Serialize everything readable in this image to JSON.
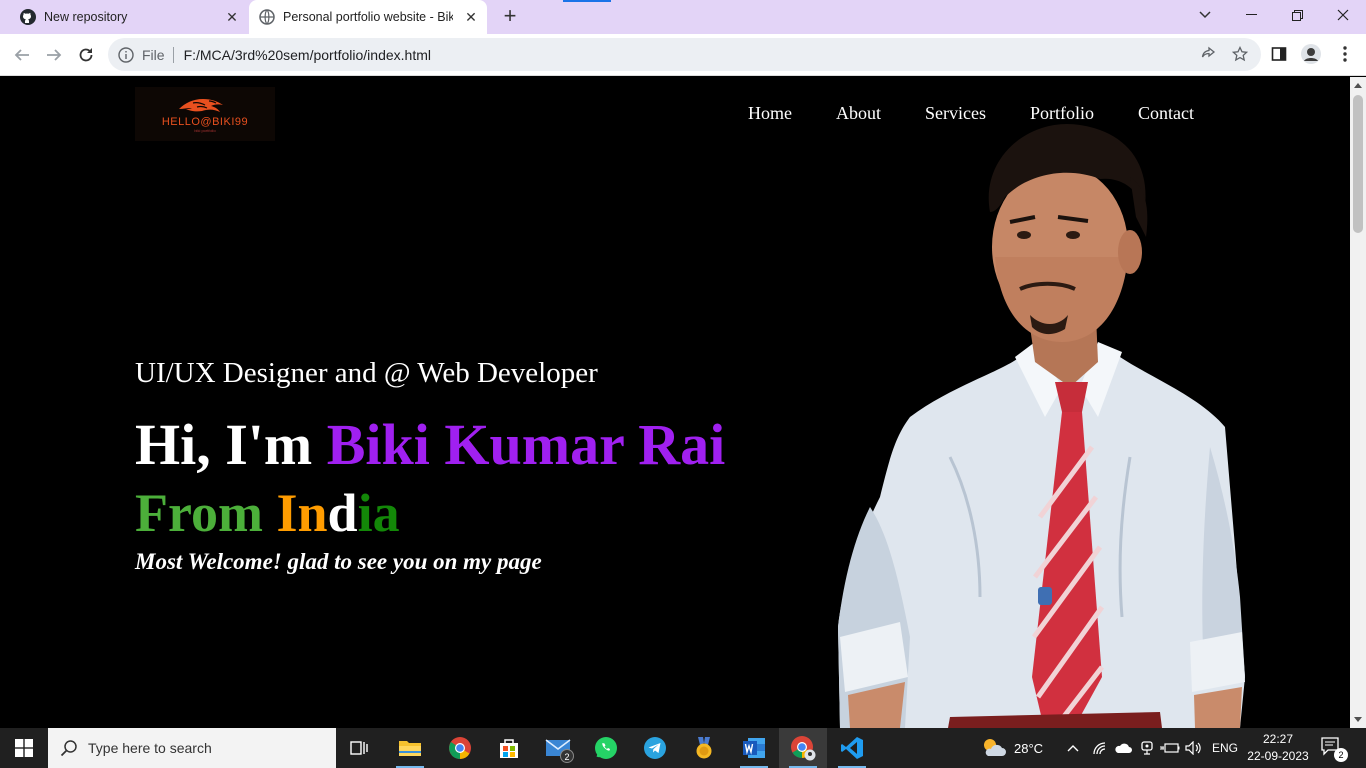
{
  "browser": {
    "tabs": [
      {
        "title": "New repository",
        "icon": "github-icon",
        "active": false
      },
      {
        "title": "Personal portfolio website - Biki",
        "icon": "globe-icon",
        "active": true
      }
    ],
    "address": {
      "scheme_label": "File",
      "url": "F:/MCA/3rd%20sem/portfolio/index.html"
    }
  },
  "page": {
    "logo": {
      "text": "HELLO@BIKI99",
      "subtext": "biki portfolio"
    },
    "nav": [
      "Home",
      "About",
      "Services",
      "Portfolio",
      "Contact"
    ],
    "subtitle": "UI/UX Designer and @ Web Developer",
    "headline_prefix": "Hi, I'm ",
    "headline_name": "Biki Kumar Rai",
    "origin_parts": [
      "From ",
      "In",
      "d",
      "ia"
    ],
    "tagline": "Most Welcome! glad to see you on my page"
  },
  "taskbar": {
    "search_placeholder": "Type here to search",
    "apps": [
      "task-view",
      "file-explorer",
      "chrome",
      "microsoft-store",
      "mail",
      "whatsapp",
      "telegram",
      "medal",
      "word",
      "chrome-profile",
      "vscode"
    ],
    "mail_badge": "2",
    "weather": "28°C",
    "language": "ENG",
    "time": "22:27",
    "date": "22-09-2023",
    "notifications": "2"
  },
  "colors": {
    "name": "#a020f0",
    "green": "#4caf3a",
    "saffron": "#ff9c00",
    "dark_green": "#138808",
    "tabstrip": "#e3d4f7"
  }
}
